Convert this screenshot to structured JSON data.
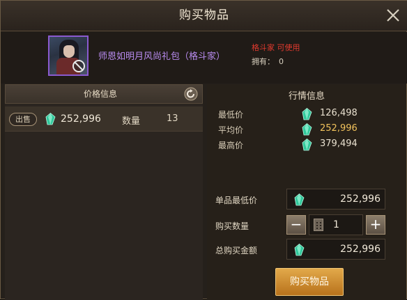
{
  "dialog": {
    "title": "购买物品"
  },
  "item": {
    "name": "师恩如明月风尚礼包（格斗家）",
    "class_requirement": "格斗家 可使用",
    "owned_label": "拥有：",
    "owned_count": "0"
  },
  "price_panel": {
    "header": "价格信息",
    "listings": [
      {
        "badge": "出售",
        "price": "252,996",
        "qty_label": "数量",
        "qty": "13"
      }
    ]
  },
  "market": {
    "title": "行情信息",
    "stats": [
      {
        "label": "最低价",
        "value": "126,498"
      },
      {
        "label": "平均价",
        "value": "252,996"
      },
      {
        "label": "最高价",
        "value": "379,494"
      }
    ]
  },
  "purchase": {
    "unit_price_label": "单品最低价",
    "unit_price": "252,996",
    "quantity_label": "购买数量",
    "quantity": "1",
    "minus": "−",
    "plus": "+",
    "total_label": "总购买金额",
    "total": "252,996",
    "buy_button": "购买物品"
  },
  "colors": {
    "accent_gold": "#f2c35c",
    "item_purple": "#b98cf0",
    "requirement_red": "#e23a2e",
    "button_orange": "#d8922e"
  },
  "icons": [
    "close-icon",
    "no-entry-icon",
    "refresh-icon",
    "gem-icon",
    "calculator-icon"
  ]
}
